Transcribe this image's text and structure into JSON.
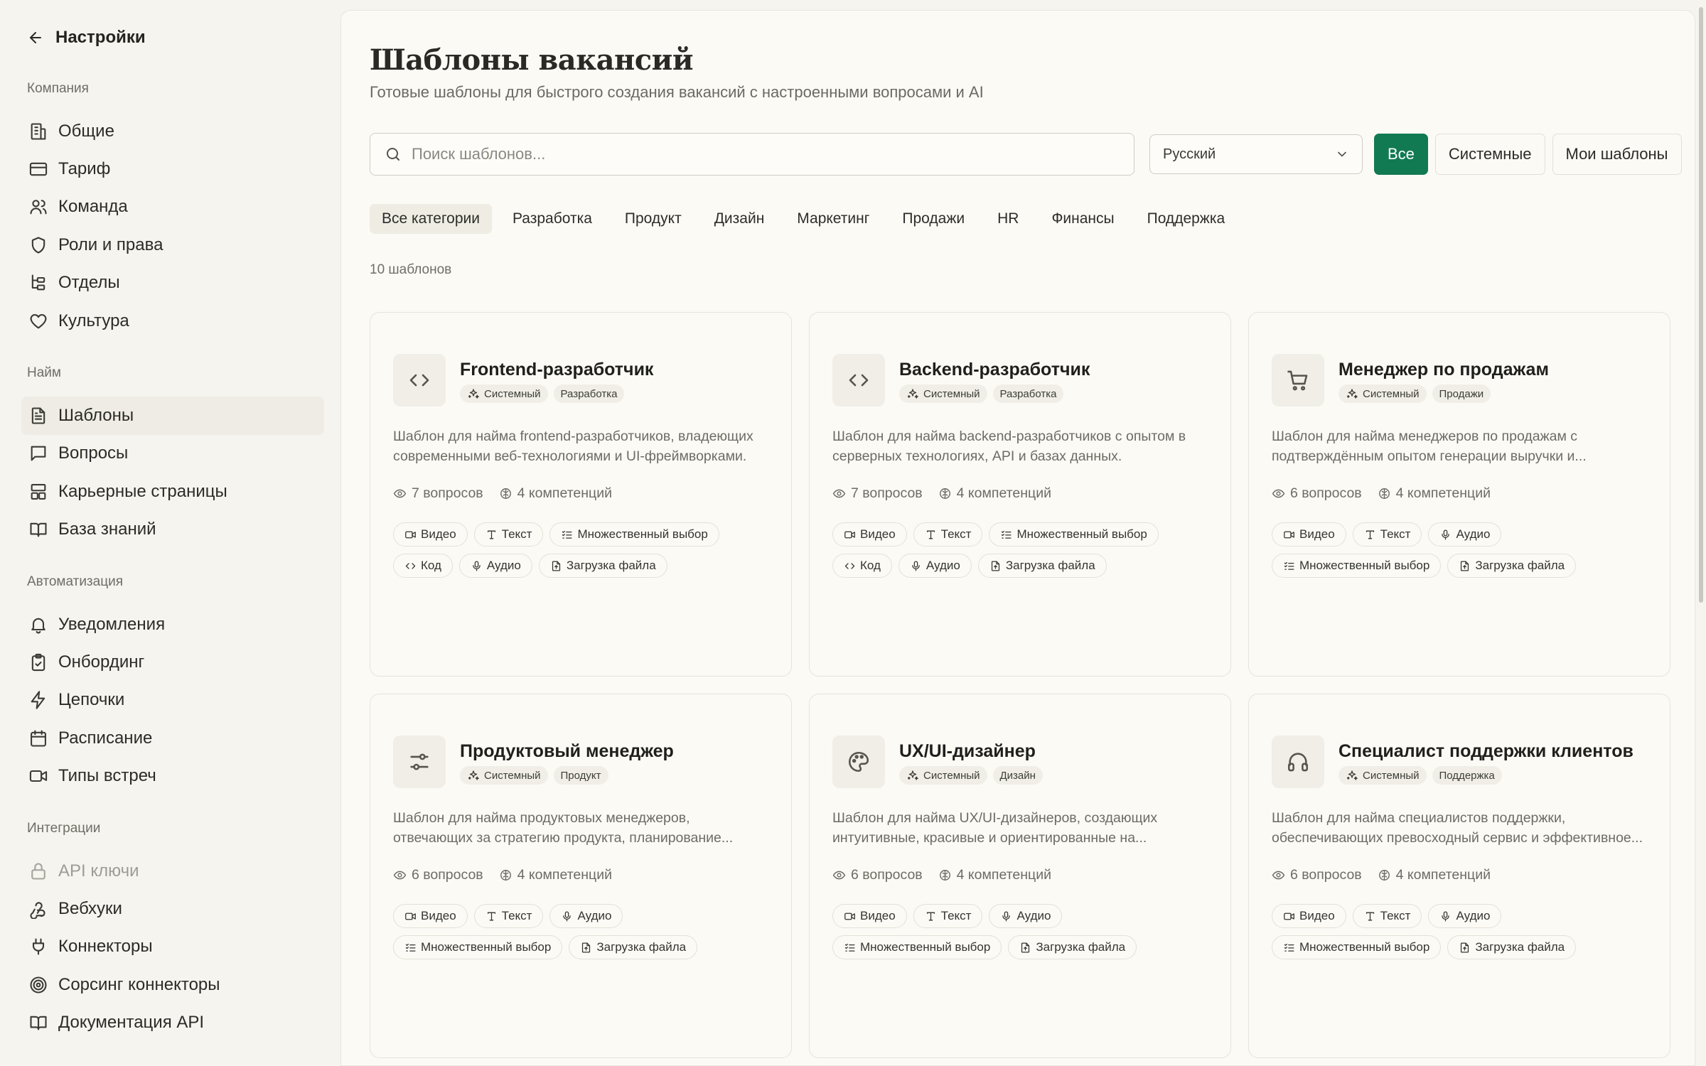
{
  "sidebar": {
    "back_label": "Настройки",
    "sections": [
      {
        "label": "Компания",
        "items": [
          {
            "label": "Общие",
            "icon": "building-icon"
          },
          {
            "label": "Тариф",
            "icon": "credit-card-icon"
          },
          {
            "label": "Команда",
            "icon": "users-icon"
          },
          {
            "label": "Роли и права",
            "icon": "shield-icon"
          },
          {
            "label": "Отделы",
            "icon": "org-chart-icon"
          },
          {
            "label": "Культура",
            "icon": "heart-icon"
          }
        ]
      },
      {
        "label": "Найм",
        "items": [
          {
            "label": "Шаблоны",
            "icon": "file-text-icon",
            "active": true
          },
          {
            "label": "Вопросы",
            "icon": "message-square-icon"
          },
          {
            "label": "Карьерные страницы",
            "icon": "layout-icon"
          },
          {
            "label": "База знаний",
            "icon": "book-open-icon"
          }
        ]
      },
      {
        "label": "Автоматизация",
        "items": [
          {
            "label": "Уведомления",
            "icon": "bell-icon"
          },
          {
            "label": "Онбординг",
            "icon": "clipboard-check-icon"
          },
          {
            "label": "Цепочки",
            "icon": "zap-icon"
          },
          {
            "label": "Расписание",
            "icon": "calendar-icon"
          },
          {
            "label": "Типы встреч",
            "icon": "video-icon"
          }
        ]
      },
      {
        "label": "Интеграции",
        "items": [
          {
            "label": "API ключи",
            "icon": "lock-icon",
            "disabled": true
          },
          {
            "label": "Вебхуки",
            "icon": "webhook-icon"
          },
          {
            "label": "Коннекторы",
            "icon": "plug-icon"
          },
          {
            "label": "Сорсинг коннекторы",
            "icon": "target-icon"
          },
          {
            "label": "Документация API",
            "icon": "book-icon"
          }
        ]
      }
    ]
  },
  "header": {
    "title": "Шаблоны вакансий",
    "subtitle": "Готовые шаблоны для быстрого создания вакансий с настроенными вопросами и AI"
  },
  "toolbar": {
    "search_placeholder": "Поиск шаблонов...",
    "language_value": "Русский",
    "filters": [
      {
        "label": "Все",
        "active": true
      },
      {
        "label": "Системные"
      },
      {
        "label": "Мои шаблоны"
      }
    ]
  },
  "categories": [
    {
      "label": "Все категории",
      "active": true
    },
    {
      "label": "Разработка"
    },
    {
      "label": "Продукт"
    },
    {
      "label": "Дизайн"
    },
    {
      "label": "Маркетинг"
    },
    {
      "label": "Продажи"
    },
    {
      "label": "HR"
    },
    {
      "label": "Финансы"
    },
    {
      "label": "Поддержка"
    }
  ],
  "template_count": "10 шаблонов",
  "colors": {
    "accent": "#127a53",
    "background": "#f6f4ee",
    "panel": "#fbfaf5"
  },
  "cards": [
    {
      "title": "Frontend-разработчик",
      "icon": "code-icon",
      "badge_system": "Системный",
      "badge_category": "Разработка",
      "description": "Шаблон для найма frontend-разработчиков, владеющих современными веб-технологиями и UI-фреймворками.",
      "questions": "7 вопросов",
      "competencies": "4 компетенций",
      "chips": [
        {
          "label": "Видео",
          "icon": "video-icon"
        },
        {
          "label": "Текст",
          "icon": "type-icon"
        },
        {
          "label": "Множественный выбор",
          "icon": "list-checks-icon"
        },
        {
          "label": "Код",
          "icon": "code-icon"
        },
        {
          "label": "Аудио",
          "icon": "mic-icon"
        },
        {
          "label": "Загрузка файла",
          "icon": "file-upload-icon"
        }
      ]
    },
    {
      "title": "Backend-разработчик",
      "icon": "code-icon",
      "badge_system": "Системный",
      "badge_category": "Разработка",
      "description": "Шаблон для найма backend-разработчиков с опытом в серверных технологиях, API и базах данных.",
      "questions": "7 вопросов",
      "competencies": "4 компетенций",
      "chips": [
        {
          "label": "Видео",
          "icon": "video-icon"
        },
        {
          "label": "Текст",
          "icon": "type-icon"
        },
        {
          "label": "Множественный выбор",
          "icon": "list-checks-icon"
        },
        {
          "label": "Код",
          "icon": "code-icon"
        },
        {
          "label": "Аудио",
          "icon": "mic-icon"
        },
        {
          "label": "Загрузка файла",
          "icon": "file-upload-icon"
        }
      ]
    },
    {
      "title": "Менеджер по продажам",
      "icon": "cart-icon",
      "badge_system": "Системный",
      "badge_category": "Продажи",
      "description": "Шаблон для найма менеджеров по продажам с подтверждённым опытом генерации выручки и...",
      "questions": "6 вопросов",
      "competencies": "4 компетенций",
      "chips": [
        {
          "label": "Видео",
          "icon": "video-icon"
        },
        {
          "label": "Текст",
          "icon": "type-icon"
        },
        {
          "label": "Аудио",
          "icon": "mic-icon"
        },
        {
          "label": "Множественный выбор",
          "icon": "list-checks-icon"
        },
        {
          "label": "Загрузка файла",
          "icon": "file-upload-icon"
        }
      ]
    },
    {
      "title": "Продуктовый менеджер",
      "icon": "sliders-icon",
      "badge_system": "Системный",
      "badge_category": "Продукт",
      "description": "Шаблон для найма продуктовых менеджеров, отвечающих за стратегию продукта, планирование...",
      "questions": "6 вопросов",
      "competencies": "4 компетенций",
      "chips": [
        {
          "label": "Видео",
          "icon": "video-icon"
        },
        {
          "label": "Текст",
          "icon": "type-icon"
        },
        {
          "label": "Аудио",
          "icon": "mic-icon"
        },
        {
          "label": "Множественный выбор",
          "icon": "list-checks-icon"
        },
        {
          "label": "Загрузка файла",
          "icon": "file-upload-icon"
        }
      ]
    },
    {
      "title": "UX/UI-дизайнер",
      "icon": "palette-icon",
      "badge_system": "Системный",
      "badge_category": "Дизайн",
      "description": "Шаблон для найма UX/UI-дизайнеров, создающих интуитивные, красивые и ориентированные на...",
      "questions": "6 вопросов",
      "competencies": "4 компетенций",
      "chips": [
        {
          "label": "Видео",
          "icon": "video-icon"
        },
        {
          "label": "Текст",
          "icon": "type-icon"
        },
        {
          "label": "Аудио",
          "icon": "mic-icon"
        },
        {
          "label": "Множественный выбор",
          "icon": "list-checks-icon"
        },
        {
          "label": "Загрузка файла",
          "icon": "file-upload-icon"
        }
      ]
    },
    {
      "title": "Специалист поддержки клиентов",
      "icon": "headphones-icon",
      "badge_system": "Системный",
      "badge_category": "Поддержка",
      "description": "Шаблон для найма специалистов поддержки, обеспечивающих превосходный сервис и эффективное...",
      "questions": "6 вопросов",
      "competencies": "4 компетенций",
      "chips": [
        {
          "label": "Видео",
          "icon": "video-icon"
        },
        {
          "label": "Текст",
          "icon": "type-icon"
        },
        {
          "label": "Аудио",
          "icon": "mic-icon"
        },
        {
          "label": "Множественный выбор",
          "icon": "list-checks-icon"
        },
        {
          "label": "Загрузка файла",
          "icon": "file-upload-icon"
        }
      ]
    }
  ]
}
